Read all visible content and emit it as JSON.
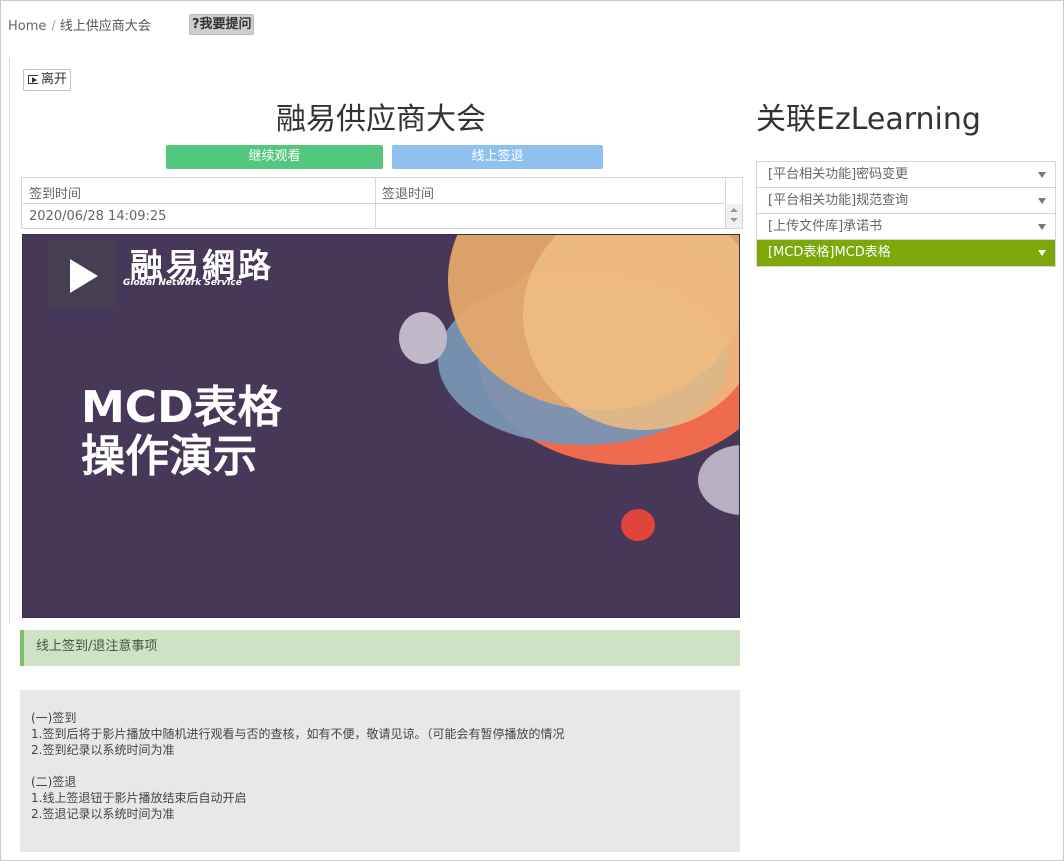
{
  "breadcrumb": {
    "home": "Home",
    "separator": "/",
    "current": "线上供应商大会"
  },
  "ask_button": "?我要提问",
  "leave_button": "离开",
  "main_title": "融易供应商大会",
  "buttons": {
    "continue": "继续观看",
    "signout": "线上签退"
  },
  "time_table": {
    "headers": [
      "签到时间",
      "签退时间"
    ],
    "rows": [
      [
        "2020/06/28 14:09:25",
        ""
      ]
    ]
  },
  "video": {
    "logo_text": "融易網路",
    "logo_sub": "Global Network Service",
    "title_lines": [
      "MCD表格",
      "操作演示"
    ]
  },
  "notice": {
    "title": "线上签到/退注意事项",
    "lines": [
      "(一)签到",
      "1.签到后将于影片播放中随机进行观看与否的查核，如有不便，敬请见谅。（可能会有暂停播放的情况",
      "2.签到纪录以系统时间为准",
      "",
      "(二)签退",
      "1.线上签退钮于影片播放结束后自动开启",
      "2.签退记录以系统时间为准"
    ]
  },
  "right_panel": {
    "title": "关联EzLearning",
    "items": [
      {
        "label": "[平台相关功能]密码变更",
        "active": false
      },
      {
        "label": "[平台相关功能]规范查询",
        "active": false
      },
      {
        "label": "[上传文件库]承诺书",
        "active": false
      },
      {
        "label": "[MCD表格]MCD表格",
        "active": true
      }
    ]
  },
  "colors": {
    "accent_green": "#7ca80a",
    "continue_green": "#52c77d",
    "signout_blue": "#8fc1ef",
    "video_bg": "#47385a"
  }
}
